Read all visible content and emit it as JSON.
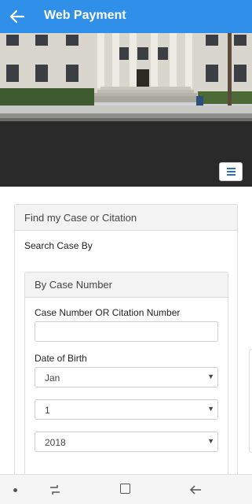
{
  "appbar": {
    "title": "Web Payment",
    "back_icon": "arrow-left-icon",
    "background": "#2f8fe9"
  },
  "hero": {
    "menu_icon": "hamburger-icon"
  },
  "panel": {
    "heading": "Find my Case or Citation",
    "search_by": "Search Case By",
    "subpanel": {
      "heading": "By Case Number",
      "case_label": "Case Number OR Citation Number",
      "case_value": "",
      "dob_label": "Date of Birth",
      "month": "Jan",
      "day": "1",
      "year": "2018"
    }
  },
  "system_nav": {
    "icons": [
      "dot-icon",
      "recent-apps-icon",
      "home-icon",
      "back-icon"
    ]
  }
}
